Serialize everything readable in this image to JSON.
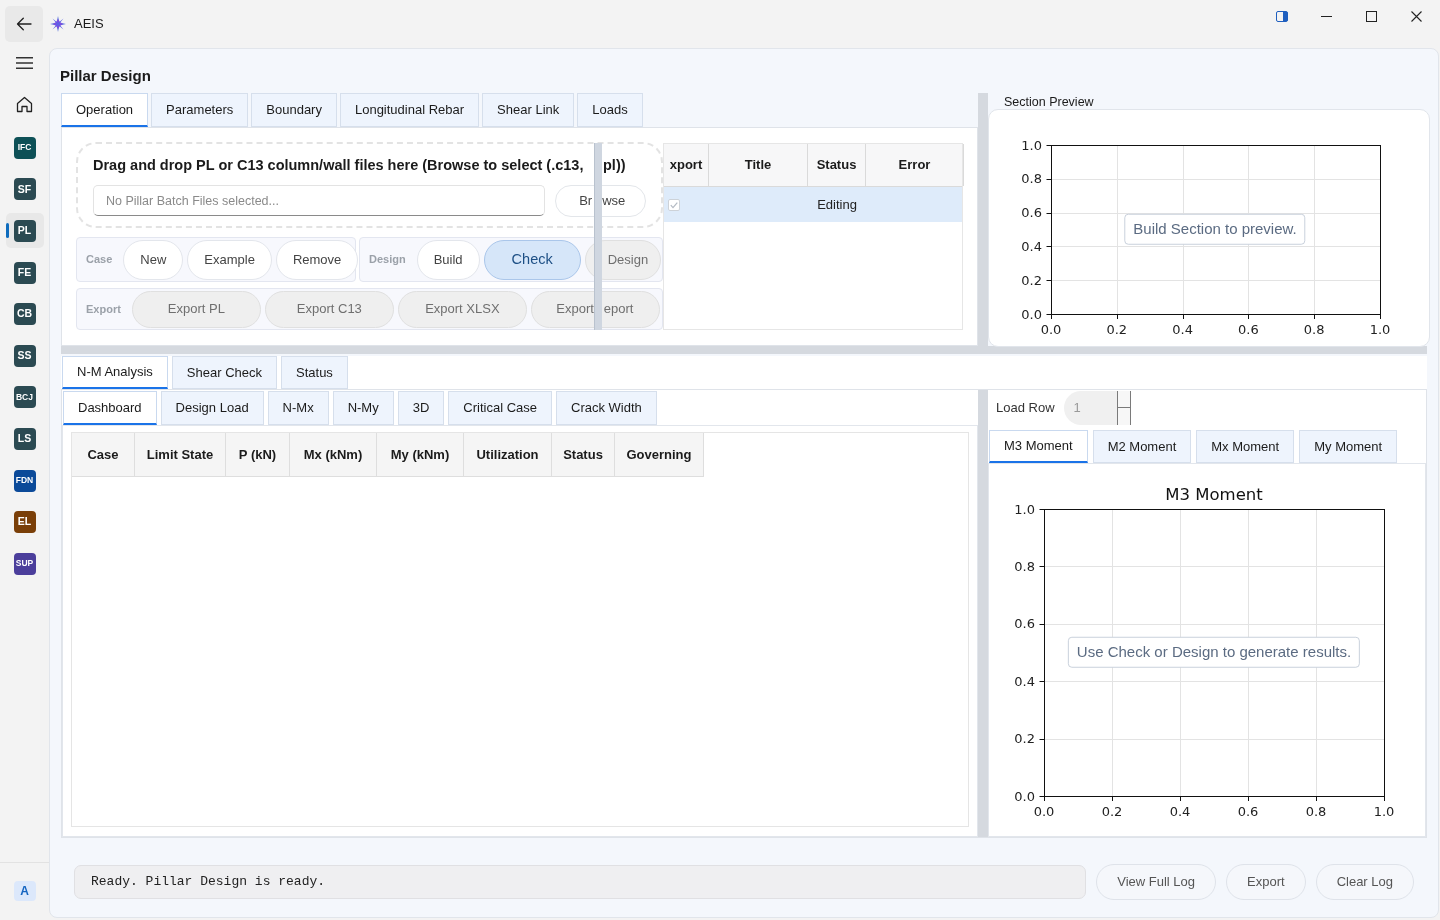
{
  "window": {
    "title": "AEIS"
  },
  "sidebar": {
    "modules": [
      {
        "label": "IFC",
        "color": "#0d5056",
        "selected": false
      },
      {
        "label": "SF",
        "color": "#2b4a52",
        "selected": false
      },
      {
        "label": "PL",
        "color": "#2b4a52",
        "selected": true
      },
      {
        "label": "FE",
        "color": "#2b4a52",
        "selected": false
      },
      {
        "label": "CB",
        "color": "#2b4a52",
        "selected": false
      },
      {
        "label": "SS",
        "color": "#2b4a52",
        "selected": false
      },
      {
        "label": "BCJ",
        "color": "#2b4a52",
        "selected": false
      },
      {
        "label": "LS",
        "color": "#2b4a52",
        "selected": false
      },
      {
        "label": "FDN",
        "color": "#0b4a99",
        "selected": false
      },
      {
        "label": "EL",
        "color": "#7a3f08",
        "selected": false
      },
      {
        "label": "SUP",
        "color": "#4b3e9b",
        "selected": false
      }
    ],
    "footer_badge": "A"
  },
  "page": {
    "title": "Pillar Design"
  },
  "top_tabs": [
    {
      "label": "Operation",
      "selected": true
    },
    {
      "label": "Parameters",
      "selected": false
    },
    {
      "label": "Boundary",
      "selected": false
    },
    {
      "label": "Longitudinal Rebar",
      "selected": false
    },
    {
      "label": "Shear Link",
      "selected": false
    },
    {
      "label": "Loads",
      "selected": false
    }
  ],
  "operation": {
    "drop_zone": {
      "title": [
        "Drag and drop PL or C13 column/wall files here (Browse to select (.c13,",
        "pl))"
      ],
      "placeholder": "No Pillar Batch Files selected...",
      "browse_button": [
        "Br",
        "wse"
      ]
    },
    "button_groups": [
      {
        "label": "Case",
        "buttons": [
          {
            "label": "New",
            "selected": false,
            "disabled": false
          },
          {
            "label": "Example",
            "selected": false,
            "disabled": false
          },
          {
            "label": "Remove",
            "selected": false,
            "disabled": false
          }
        ]
      },
      {
        "label": "Design",
        "buttons": [
          {
            "label": "Build",
            "selected": false,
            "disabled": false
          },
          {
            "label": "Check",
            "selected": true,
            "disabled": false
          },
          {
            "label": "Design",
            "selected": false,
            "disabled": true
          }
        ]
      },
      {
        "label": "Export",
        "buttons": [
          {
            "label": "Export PL",
            "selected": false,
            "disabled": true
          },
          {
            "label": "Export C13",
            "selected": false,
            "disabled": true
          },
          {
            "label": "Export XLSX",
            "selected": false,
            "disabled": true
          },
          {
            "label": [
              "Export",
              "eport"
            ],
            "selected": false,
            "disabled": true
          }
        ]
      }
    ],
    "files_table": {
      "columns": [
        "xport",
        "Title",
        "Status",
        "Error"
      ],
      "rows": [
        {
          "selected": true,
          "checked": true,
          "status": "Editing"
        }
      ]
    }
  },
  "section_preview": {
    "title": "Section Preview",
    "message": "Build Section to preview.",
    "chart_data": {
      "type": "line",
      "grid": true,
      "xlim": [
        0,
        1
      ],
      "ylim": [
        0,
        1
      ],
      "xticks": [
        {
          "value": 0,
          "label": "0.0"
        },
        {
          "value": 0.2,
          "label": "0.2"
        },
        {
          "value": 0.4,
          "label": "0.4"
        },
        {
          "value": 0.6,
          "label": "0.6"
        },
        {
          "value": 0.8,
          "label": "0.8"
        },
        {
          "value": 1,
          "label": "1.0"
        }
      ],
      "yticks": [
        {
          "value": 0,
          "label": "0.0"
        },
        {
          "value": 0.2,
          "label": "0.2"
        },
        {
          "value": 0.4,
          "label": "0.4"
        },
        {
          "value": 0.6,
          "label": "0.6"
        },
        {
          "value": 0.8,
          "label": "0.8"
        },
        {
          "value": 1,
          "label": "1.0"
        }
      ]
    }
  },
  "result_tabs": [
    {
      "label": "N-M Analysis",
      "selected": true
    },
    {
      "label": "Shear Check",
      "selected": false
    },
    {
      "label": "Status",
      "selected": false
    }
  ],
  "analysis_tabs": [
    {
      "label": "Dashboard",
      "selected": true
    },
    {
      "label": "Design Load",
      "selected": false
    },
    {
      "label": "N-Mx",
      "selected": false
    },
    {
      "label": "N-My",
      "selected": false
    },
    {
      "label": "3D",
      "selected": false
    },
    {
      "label": "Critical Case",
      "selected": false
    },
    {
      "label": "Crack Width",
      "selected": false
    }
  ],
  "results_table": {
    "columns": [
      "Case",
      "Limit State",
      "P (kN)",
      "Mx (kNm)",
      "My (kNm)",
      "Utilization",
      "Status",
      "Governing"
    ]
  },
  "load_row": {
    "label": "Load Row",
    "value": "1"
  },
  "moment_tabs": [
    {
      "label": "M3 Moment",
      "selected": true
    },
    {
      "label": "M2 Moment",
      "selected": false
    },
    {
      "label": "Mx Moment",
      "selected": false
    },
    {
      "label": "My Moment",
      "selected": false
    }
  ],
  "moment_chart": {
    "message": "Use Check or Design to generate results.",
    "chart_data": {
      "type": "line",
      "title": "M3 Moment",
      "grid": true,
      "xlim": [
        0,
        1
      ],
      "ylim": [
        0,
        1
      ],
      "xticks": [
        {
          "value": 0,
          "label": "0.0"
        },
        {
          "value": 0.2,
          "label": "0.2"
        },
        {
          "value": 0.4,
          "label": "0.4"
        },
        {
          "value": 0.6,
          "label": "0.6"
        },
        {
          "value": 0.8,
          "label": "0.8"
        },
        {
          "value": 1,
          "label": "1.0"
        }
      ],
      "yticks": [
        {
          "value": 0,
          "label": "0.0"
        },
        {
          "value": 0.2,
          "label": "0.2"
        },
        {
          "value": 0.4,
          "label": "0.4"
        },
        {
          "value": 0.6,
          "label": "0.6"
        },
        {
          "value": 0.8,
          "label": "0.8"
        },
        {
          "value": 1,
          "label": "1.0"
        }
      ]
    }
  },
  "status_bar": {
    "message": "Ready. Pillar Design is ready.",
    "buttons": [
      "View Full Log",
      "Export",
      "Clear Log"
    ]
  }
}
